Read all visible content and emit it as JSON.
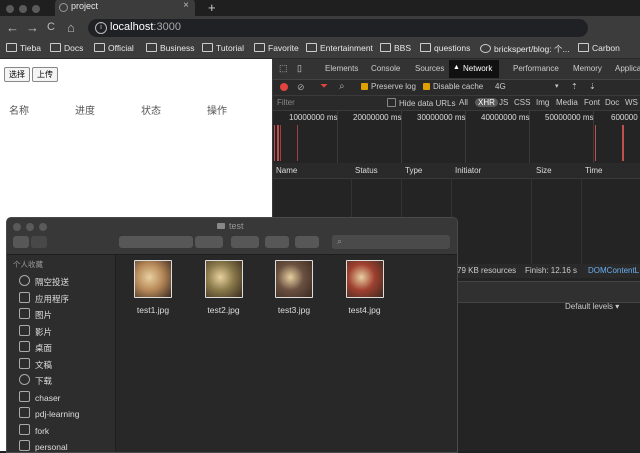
{
  "browser": {
    "tab_title": "project",
    "tab_close": "×",
    "new_tab": "+",
    "nav": {
      "back": "←",
      "forward": "→",
      "reload": "C",
      "home": "⌂"
    },
    "url_host": "localhost",
    "url_port": ":3000",
    "bookmarks": [
      "Tieba",
      "Docs",
      "Official",
      "Business",
      "Tutorial",
      "Favorite",
      "Entertainment",
      "BBS",
      "questions",
      "brickspert/blog: 个...",
      "Carbon"
    ]
  },
  "page": {
    "buttons": {
      "choose": "选择",
      "upload": "上传"
    },
    "table_headers": [
      "名称",
      "进度",
      "状态",
      "操作"
    ]
  },
  "devtools": {
    "tabs": [
      "Elements",
      "Console",
      "Sources",
      "Network",
      "Performance",
      "Memory",
      "Applica"
    ],
    "active_tab": "Network",
    "preserve_log": "Preserve log",
    "disable_cache": "Disable cache",
    "throttle": "4G",
    "filter_placeholder": "Filter",
    "hide_data_urls": "Hide data URLs",
    "filter_types": [
      "All",
      "XHR",
      "JS",
      "CSS",
      "Img",
      "Media",
      "Font",
      "Doc",
      "WS"
    ],
    "timeline_labels": [
      "10000000 ms",
      "20000000 ms",
      "30000000 ms",
      "40000000 ms",
      "50000000 ms",
      "600000"
    ],
    "columns": [
      "Name",
      "Status",
      "Type",
      "Initiator",
      "Size",
      "Time"
    ],
    "status_resources": "79 KB resources",
    "status_finish": "Finish: 12.16 s",
    "status_domcontent": "DOMContentL",
    "default_levels": "Default levels ▾"
  },
  "finder": {
    "title": "test",
    "sidebar_header": "个人收藏",
    "sidebar_items": [
      {
        "label": "隔空投送",
        "icon": "airdrop-icon"
      },
      {
        "label": "应用程序",
        "icon": "applications-icon"
      },
      {
        "label": "图片",
        "icon": "pictures-icon"
      },
      {
        "label": "影片",
        "icon": "movies-icon"
      },
      {
        "label": "桌面",
        "icon": "desktop-icon"
      },
      {
        "label": "文稿",
        "icon": "documents-icon"
      },
      {
        "label": "下载",
        "icon": "downloads-icon"
      },
      {
        "label": "chaser",
        "icon": "home-icon"
      },
      {
        "label": "pdj-learning",
        "icon": "folder-icon"
      },
      {
        "label": "fork",
        "icon": "folder-icon"
      },
      {
        "label": "personal",
        "icon": "folder-icon"
      }
    ],
    "files": [
      {
        "name": "test1.jpg",
        "color": "#b88a5a"
      },
      {
        "name": "test2.jpg",
        "color": "#8a7a4a"
      },
      {
        "name": "test3.jpg",
        "color": "#6a5040"
      },
      {
        "name": "test4.jpg",
        "color": "#a04030"
      }
    ]
  }
}
